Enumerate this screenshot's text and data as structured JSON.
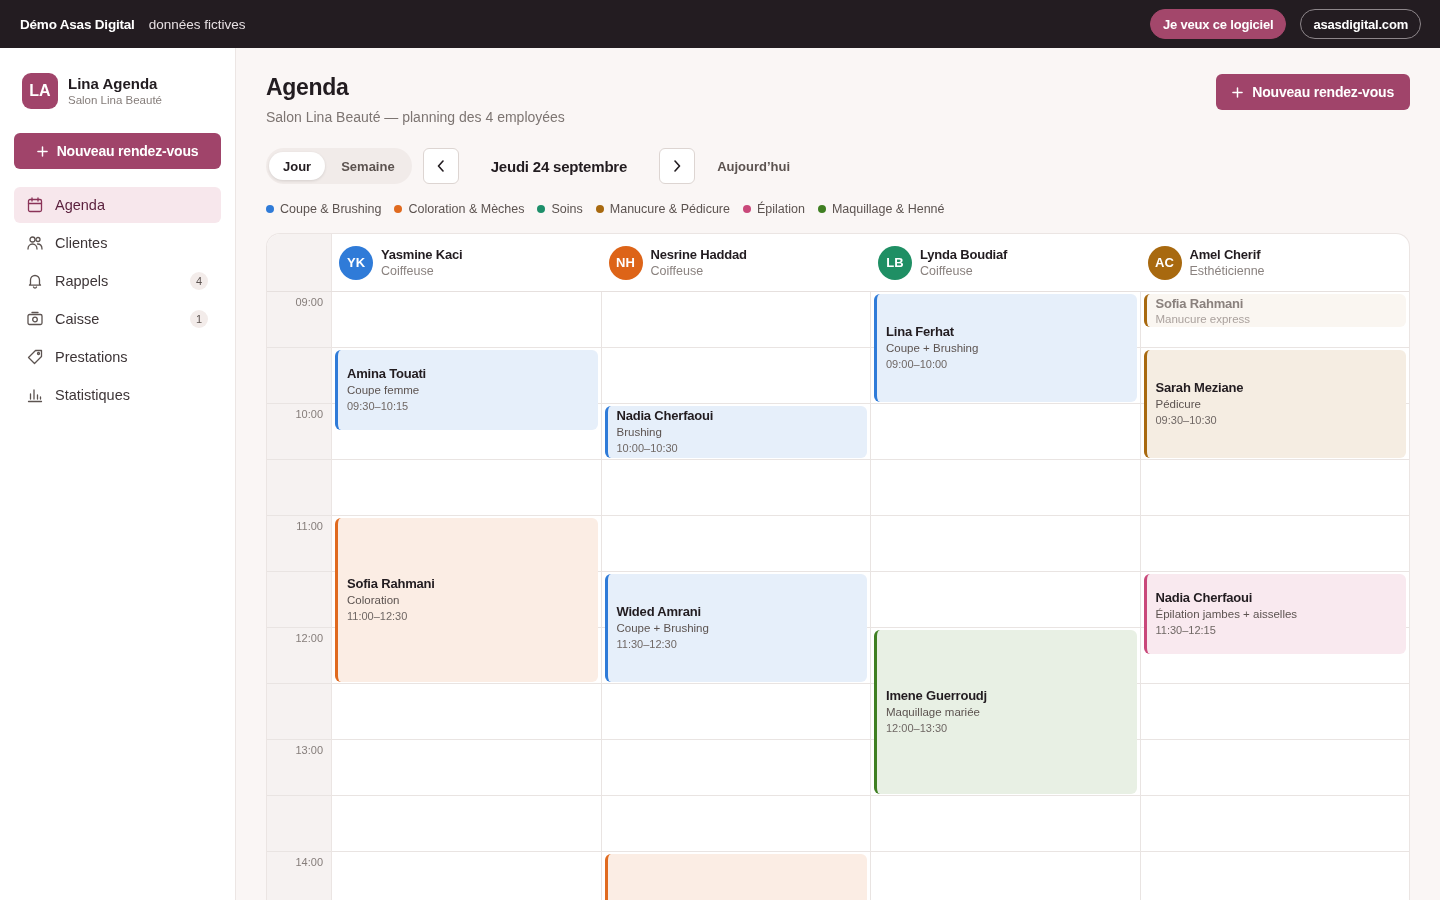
{
  "topbar": {
    "brand": "Démo Asas Digital",
    "tagline": "données fictives",
    "buttons": [
      {
        "label": "Je veux ce logiciel",
        "kind": "primary"
      },
      {
        "label": "asasdigital.com",
        "kind": "outline"
      }
    ]
  },
  "sidebar": {
    "logo": "LA",
    "app_name": "Lina Agenda",
    "salon": "Salon Lina Beauté",
    "new_button": "Nouveau rendez-vous",
    "items": [
      {
        "label": "Agenda",
        "selected": true
      },
      {
        "label": "Clientes",
        "selected": false
      },
      {
        "label": "Rappels",
        "selected": false,
        "badge": "4"
      },
      {
        "label": "Caisse",
        "selected": false,
        "badge": "1"
      },
      {
        "label": "Prestations",
        "selected": false
      },
      {
        "label": "Statistiques",
        "selected": false
      }
    ]
  },
  "header": {
    "title": "Agenda",
    "subtitle": "Salon Lina Beauté — planning des 4 employées",
    "new_button": "Nouveau rendez-vous"
  },
  "toolbar": {
    "views": [
      {
        "label": "Jour",
        "selected": true
      },
      {
        "label": "Semaine",
        "selected": false
      }
    ],
    "date": "Jeudi 24 septembre",
    "today": "Aujourd’hui"
  },
  "legend": [
    {
      "label": "Coupe & Brushing",
      "color": "#2f7bd8"
    },
    {
      "label": "Coloration & Mèches",
      "color": "#e06a1f"
    },
    {
      "label": "Soins",
      "color": "#1d8f6a"
    },
    {
      "label": "Manucure & Pédicure",
      "color": "#a8690f"
    },
    {
      "label": "Épilation",
      "color": "#c9487a"
    },
    {
      "label": "Maquillage & Henné",
      "color": "#3f7f22"
    }
  ],
  "calendar": {
    "hours": [
      "09:00",
      "10:00",
      "11:00",
      "12:00",
      "13:00",
      "14:00"
    ],
    "columns": [
      {
        "initials": "YK",
        "name": "Yasmine Kaci",
        "role": "Coiffeuse",
        "color": "#2f7bd8",
        "events": [
          {
            "kind": "timed",
            "client": "Amina Touati",
            "service": "Coupe femme",
            "time": "09:30–10:15",
            "color": "#2f7bd8",
            "faded": false
          },
          {
            "kind": "timed",
            "client": "Sofia Rahmani",
            "service": "Coloration",
            "time": "11:00–12:30",
            "color": "#e06a1f",
            "faded": false
          }
        ]
      },
      {
        "initials": "NH",
        "name": "Nesrine Haddad",
        "role": "Coiffeuse",
        "color": "#dd6418",
        "events": [
          {
            "kind": "timed",
            "client": "Nadia Cherfaoui",
            "service": "Brushing",
            "time": "10:00–10:30",
            "color": "#2f7bd8",
            "faded": false
          },
          {
            "kind": "timed",
            "client": "Wided Amrani",
            "service": "Coupe + Brushing",
            "time": "11:30–12:30",
            "color": "#2f7bd8",
            "faded": false
          },
          {
            "kind": "open",
            "color": "#e06a1f",
            "faded": false
          }
        ]
      },
      {
        "initials": "LB",
        "name": "Lynda Boudiaf",
        "role": "Coiffeuse",
        "color": "#1f8f64",
        "events": [
          {
            "kind": "timed",
            "client": "Lina Ferhat",
            "service": "Coupe + Brushing",
            "time": "09:00–10:00",
            "color": "#2f7bd8",
            "faded": false
          },
          {
            "kind": "timed",
            "client": "Imene Guerroudj",
            "service": "Maquillage mariée",
            "time": "12:00–13:30",
            "color": "#3f7f22",
            "faded": false
          }
        ]
      },
      {
        "initials": "AC",
        "name": "Amel Cherif",
        "role": "Esthéticienne",
        "color": "#a8690f",
        "events": [
          {
            "kind": "compact",
            "client": "Sofia Rahmani",
            "service": "Manucure express",
            "color": "#a8690f",
            "faded": true
          },
          {
            "kind": "timed",
            "client": "Sarah Meziane",
            "service": "Pédicure",
            "time": "09:30–10:30",
            "color": "#a8690f",
            "faded": false
          },
          {
            "kind": "timed",
            "client": "Nadia Cherfaoui",
            "service": "Épilation jambes + aisselles",
            "time": "11:30–12:15",
            "color": "#c9487a",
            "faded": false
          }
        ]
      }
    ]
  }
}
